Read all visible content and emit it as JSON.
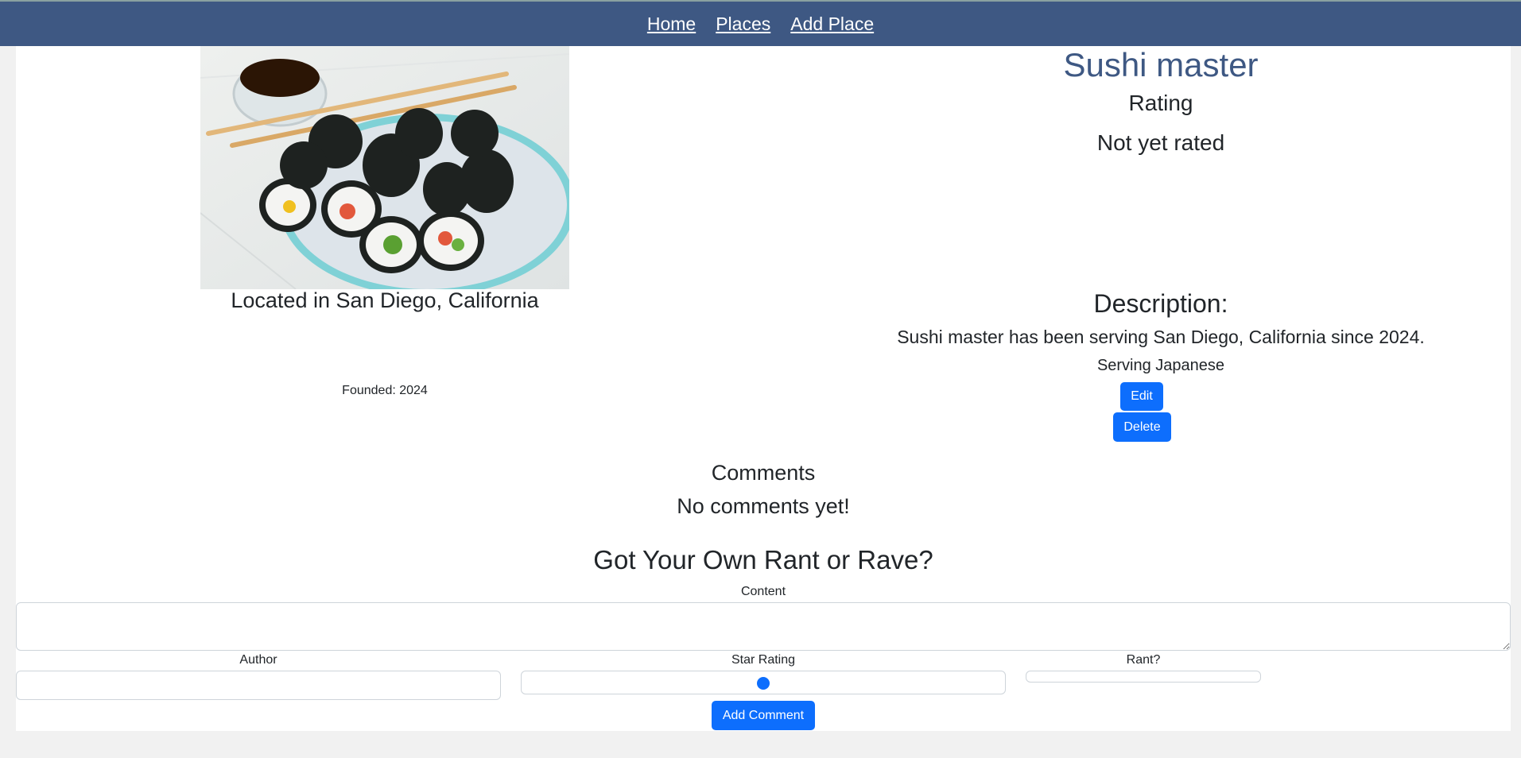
{
  "nav": {
    "home": "Home",
    "places": "Places",
    "add_place": "Add Place"
  },
  "place": {
    "name": "Sushi master",
    "rating_heading": "Rating",
    "rating_value": "Not yet rated",
    "location": "Located in San Diego, California",
    "founded": "Founded: 2024",
    "description_heading": "Description:",
    "description": "Sushi master has been serving San Diego, California since 2024.",
    "cuisine": "Serving Japanese",
    "edit_label": "Edit",
    "delete_label": "Delete"
  },
  "comments": {
    "heading": "Comments",
    "empty": "No comments yet!"
  },
  "form": {
    "heading": "Got Your Own Rant or Rave?",
    "content_label": "Content",
    "content_value": "",
    "author_label": "Author",
    "author_value": "",
    "star_label": "Star Rating",
    "star_value": 0.5,
    "rant_label": "Rant?",
    "submit_label": "Add Comment"
  },
  "colors": {
    "nav_bg": "#3e5883",
    "title": "#3e5883",
    "button": "#0d6efd"
  }
}
